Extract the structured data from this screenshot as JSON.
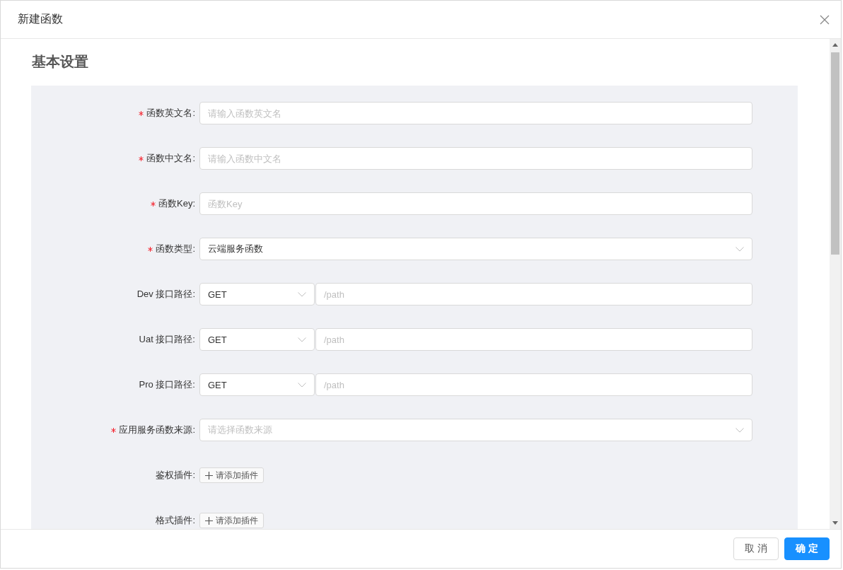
{
  "dialog": {
    "title": "新建函数"
  },
  "section": {
    "title": "基本设置"
  },
  "fields": [
    {
      "kind": "text",
      "label": "函数英文名:",
      "required": true,
      "placeholder": "请输入函数英文名"
    },
    {
      "kind": "text",
      "label": "函数中文名:",
      "required": true,
      "placeholder": "请输入函数中文名"
    },
    {
      "kind": "text",
      "label": "函数Key:",
      "required": true,
      "placeholder": "函数Key"
    },
    {
      "kind": "select",
      "label": "函数类型:",
      "required": true,
      "value": "云端服务函数"
    },
    {
      "kind": "method-path",
      "label": "Dev 接口路径:",
      "required": false,
      "method": "GET",
      "placeholder": "/path"
    },
    {
      "kind": "method-path",
      "label": "Uat 接口路径:",
      "required": false,
      "method": "GET",
      "placeholder": "/path"
    },
    {
      "kind": "method-path",
      "label": "Pro 接口路径:",
      "required": false,
      "method": "GET",
      "placeholder": "/path"
    },
    {
      "kind": "select",
      "label": "应用服务函数来源:",
      "required": true,
      "placeholder": "请选择函数来源"
    },
    {
      "kind": "plugin",
      "label": "鉴权插件:",
      "required": false,
      "button": "请添加插件"
    },
    {
      "kind": "plugin",
      "label": "格式插件:",
      "required": false,
      "button": "请添加插件"
    }
  ],
  "buttons": [
    {
      "label": "取 消",
      "primary": false
    },
    {
      "label": "确 定",
      "primary": true
    }
  ]
}
